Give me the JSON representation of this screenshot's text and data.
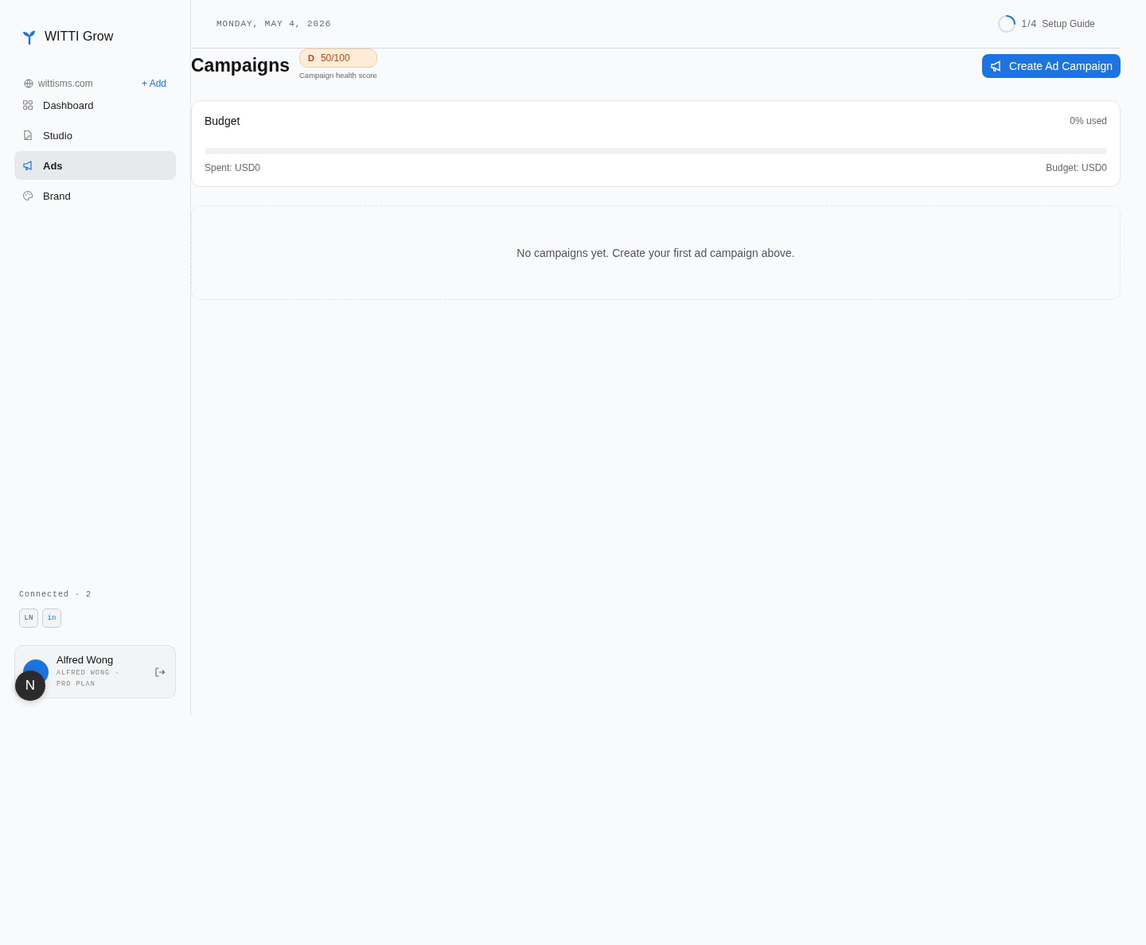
{
  "sidebar": {
    "brand": "WITTI Grow",
    "site": {
      "domain": "wittisms.com",
      "add_label": "+ Add"
    },
    "items": [
      {
        "label": "Dashboard",
        "selected": false
      },
      {
        "label": "Studio",
        "selected": false
      },
      {
        "label": "Ads",
        "selected": true
      },
      {
        "label": "Brand",
        "selected": false
      }
    ],
    "connected": {
      "label": "Connected · 2",
      "accounts": [
        "LN",
        "in"
      ]
    },
    "user": {
      "name": "Alfred Wong",
      "subtitle": "ALFRED WONG · PRO PLAN"
    },
    "dev_badge": "N"
  },
  "header": {
    "date": "MONDAY, MAY 4, 2026",
    "setup": {
      "level": 0.25,
      "count": "1/4",
      "label": "Setup Guide"
    }
  },
  "page": {
    "title": "Campaigns",
    "score": {
      "grade": "D",
      "value": "50/100",
      "caption": "Campaign health score"
    },
    "create_button": "Create Ad Campaign"
  },
  "budget": {
    "title": "Budget",
    "used": "0% used",
    "level": 0,
    "spent": "Spent: USD0",
    "total": "Budget: USD0"
  },
  "empty_state": "No campaigns yet. Create your first ad campaign above."
}
